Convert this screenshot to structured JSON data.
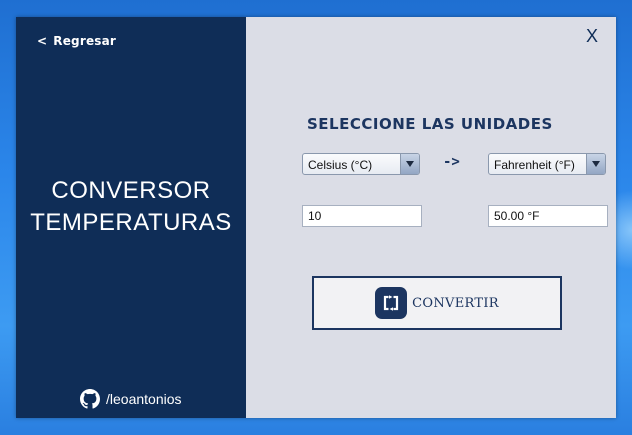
{
  "window": {
    "close_label": "X"
  },
  "sidebar": {
    "back_chevron": "<",
    "back_label": "Regresar",
    "title_line1": "CONVERSOR",
    "title_line2": "TEMPERATURAS",
    "github_label": "/leoantonios",
    "github_icon": "github-icon"
  },
  "main": {
    "section_title": "SELECCIONE LAS UNIDADES",
    "from_unit": "Celsius (°C)",
    "to_unit": "Fahrenheit (°F)",
    "arrow_label": "->",
    "input_value": "10",
    "output_value": "50.00 °F",
    "convert_label": "CONVERTIR",
    "convert_icon": "convert-icon"
  },
  "colors": {
    "sidebar_bg": "#0f2d57",
    "main_bg": "#dbdde6",
    "accent": "#1c3560"
  }
}
